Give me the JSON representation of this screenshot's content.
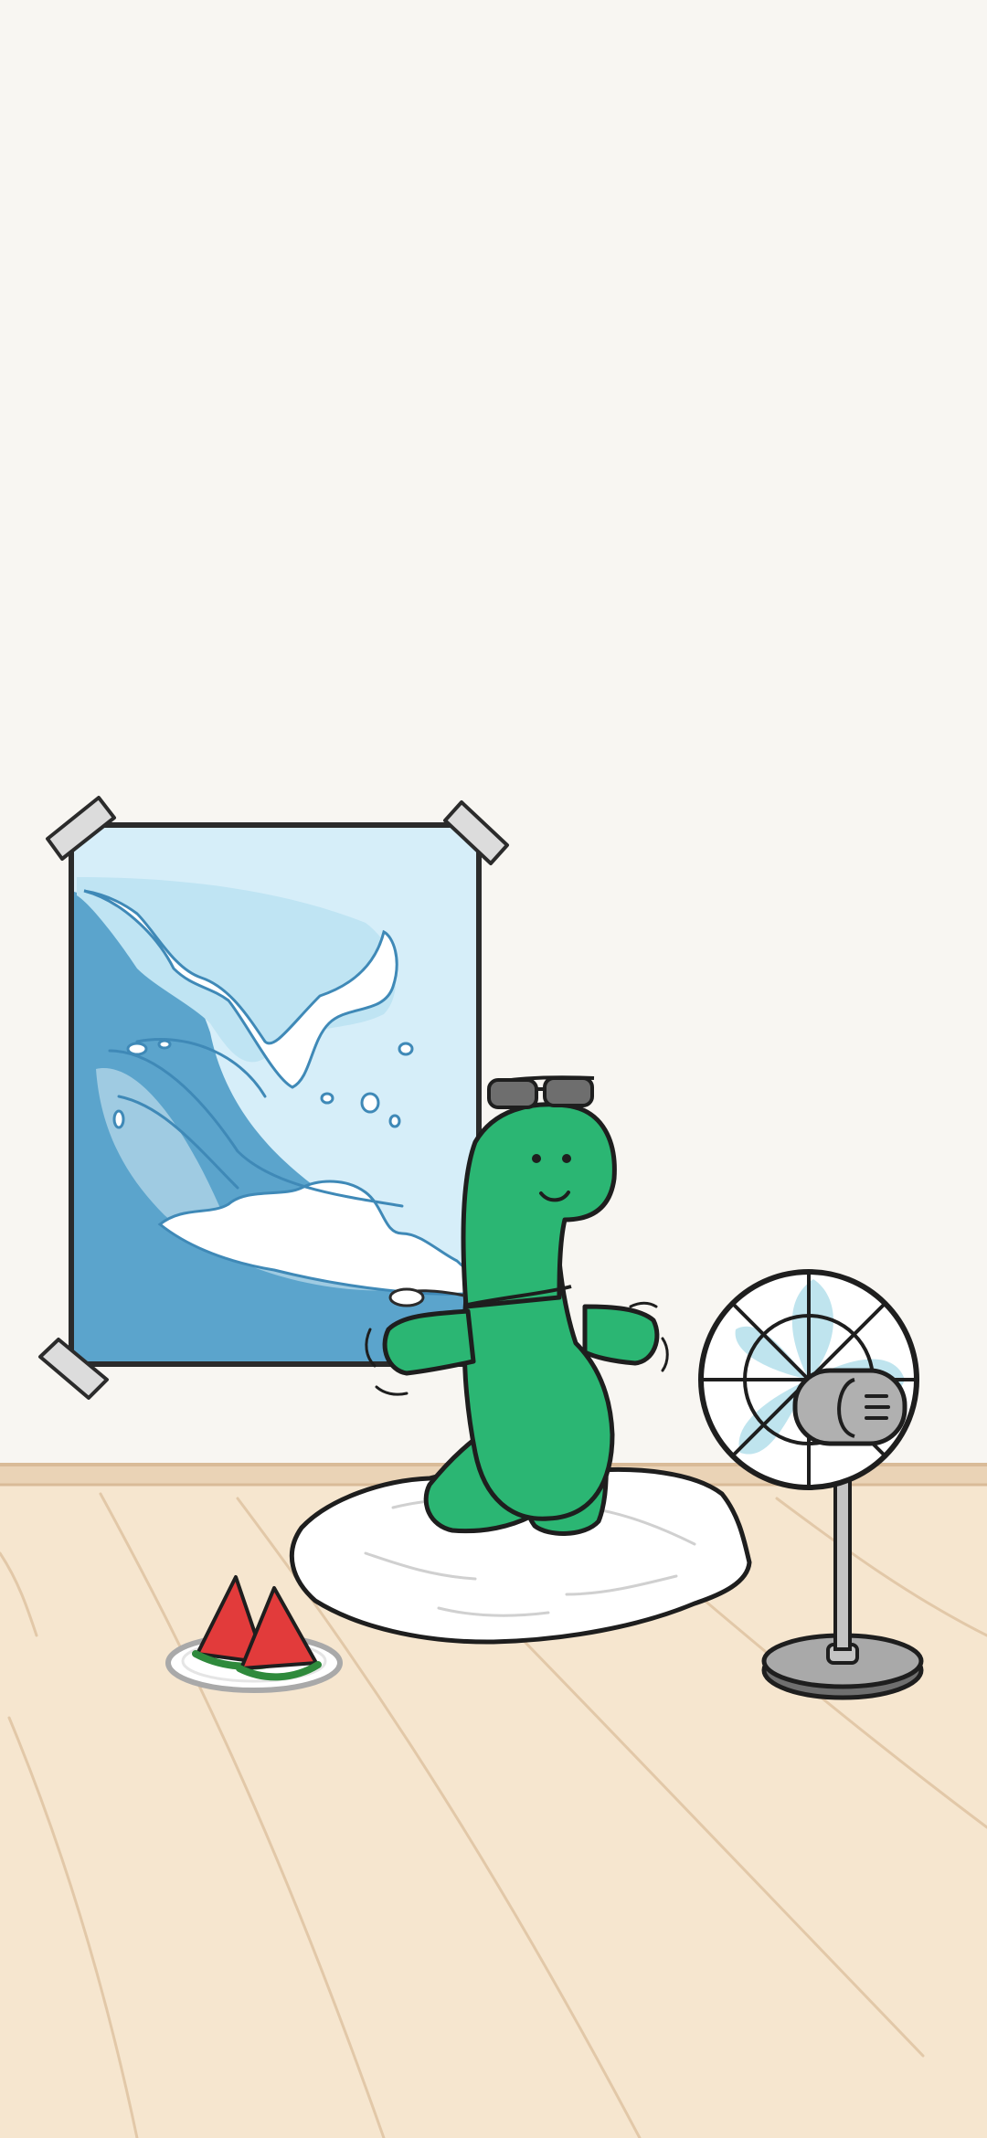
{
  "scene": {
    "kind": "illustrated phone wallpaper",
    "elements": [
      "great-wave-poster",
      "green-dinosaur-with-sunglasses",
      "white-fluffy-rug",
      "watermelon-slices-on-plate",
      "electric-fan"
    ]
  },
  "colors": {
    "wall": "#f8f6f2",
    "floor": "#f6e6cf",
    "floor_lines": "#e6cdb0",
    "baseboard": "#ead3b6",
    "outline": "#1e1e1e",
    "dino_green": "#2bb673",
    "sunglasses": "#6e6e6e",
    "poster_dark_blue": "#5ba4cc",
    "poster_light_blue": "#bfe4f3",
    "poster_sky": "#d6eef9",
    "foam": "#ffffff",
    "tape": "#dcdcdc",
    "rug": "#ffffff",
    "watermelon_red": "#e23b3b",
    "watermelon_rind": "#2f8a3c",
    "plate": "#ffffff",
    "fan_grey": "#a9a9a9",
    "fan_blade": "#bfe4ee"
  }
}
